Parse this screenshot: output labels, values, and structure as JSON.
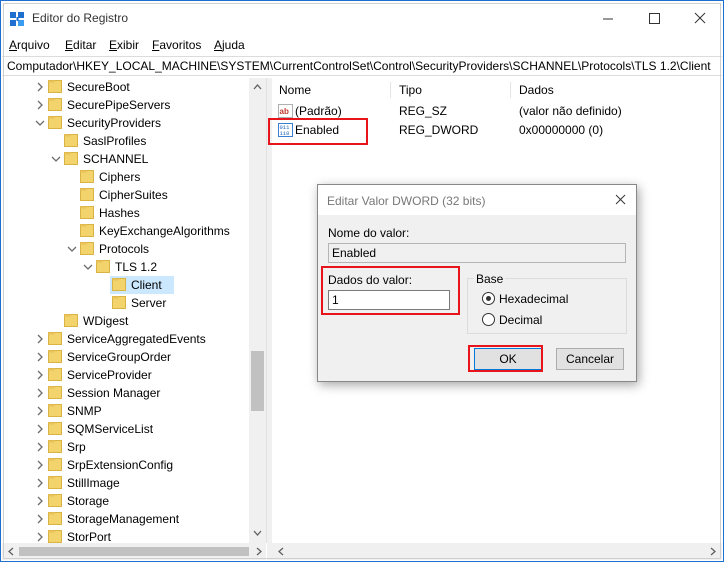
{
  "window": {
    "title": "Editor do Registro",
    "menu": [
      "Arquivo",
      "Editar",
      "Exibir",
      "Favoritos",
      "Ajuda"
    ],
    "address": "Computador\\HKEY_LOCAL_MACHINE\\SYSTEM\\CurrentControlSet\\Control\\SecurityProviders\\SCHANNEL\\Protocols\\TLS 1.2\\Client"
  },
  "tree": {
    "items": [
      {
        "label": "SecureBoot"
      },
      {
        "label": "SecurePipeServers"
      },
      {
        "label": "SecurityProviders"
      },
      {
        "label": "SaslProfiles"
      },
      {
        "label": "SCHANNEL"
      },
      {
        "label": "Ciphers"
      },
      {
        "label": "CipherSuites"
      },
      {
        "label": "Hashes"
      },
      {
        "label": "KeyExchangeAlgorithms"
      },
      {
        "label": "Protocols"
      },
      {
        "label": "TLS 1.2"
      },
      {
        "label": "Client"
      },
      {
        "label": "Server"
      },
      {
        "label": "WDigest"
      },
      {
        "label": "ServiceAggregatedEvents"
      },
      {
        "label": "ServiceGroupOrder"
      },
      {
        "label": "ServiceProvider"
      },
      {
        "label": "Session Manager"
      },
      {
        "label": "SNMP"
      },
      {
        "label": "SQMServiceList"
      },
      {
        "label": "Srp"
      },
      {
        "label": "SrpExtensionConfig"
      },
      {
        "label": "StillImage"
      },
      {
        "label": "Storage"
      },
      {
        "label": "StorageManagement"
      },
      {
        "label": "StorPort"
      }
    ]
  },
  "list": {
    "headers": {
      "name": "Nome",
      "type": "Tipo",
      "data": "Dados"
    },
    "rows": [
      {
        "name": "(Padrão)",
        "type": "REG_SZ",
        "data": "(valor não definido)",
        "icon": "string-value-icon"
      },
      {
        "name": "Enabled",
        "type": "REG_DWORD",
        "data": "0x00000000 (0)",
        "icon": "dword-value-icon"
      }
    ]
  },
  "dialog": {
    "title": "Editar Valor DWORD (32 bits)",
    "name_label": "Nome do valor:",
    "name_value": "Enabled",
    "data_label": "Dados do valor:",
    "data_value": "1",
    "base_label": "Base",
    "hex_label": "Hexadecimal",
    "dec_label": "Decimal",
    "ok_label": "OK",
    "cancel_label": "Cancelar"
  },
  "colors": {
    "highlight": "#e8141c",
    "selection": "#cce8ff",
    "folder": "#f3d36b",
    "accent": "#0078d7"
  }
}
